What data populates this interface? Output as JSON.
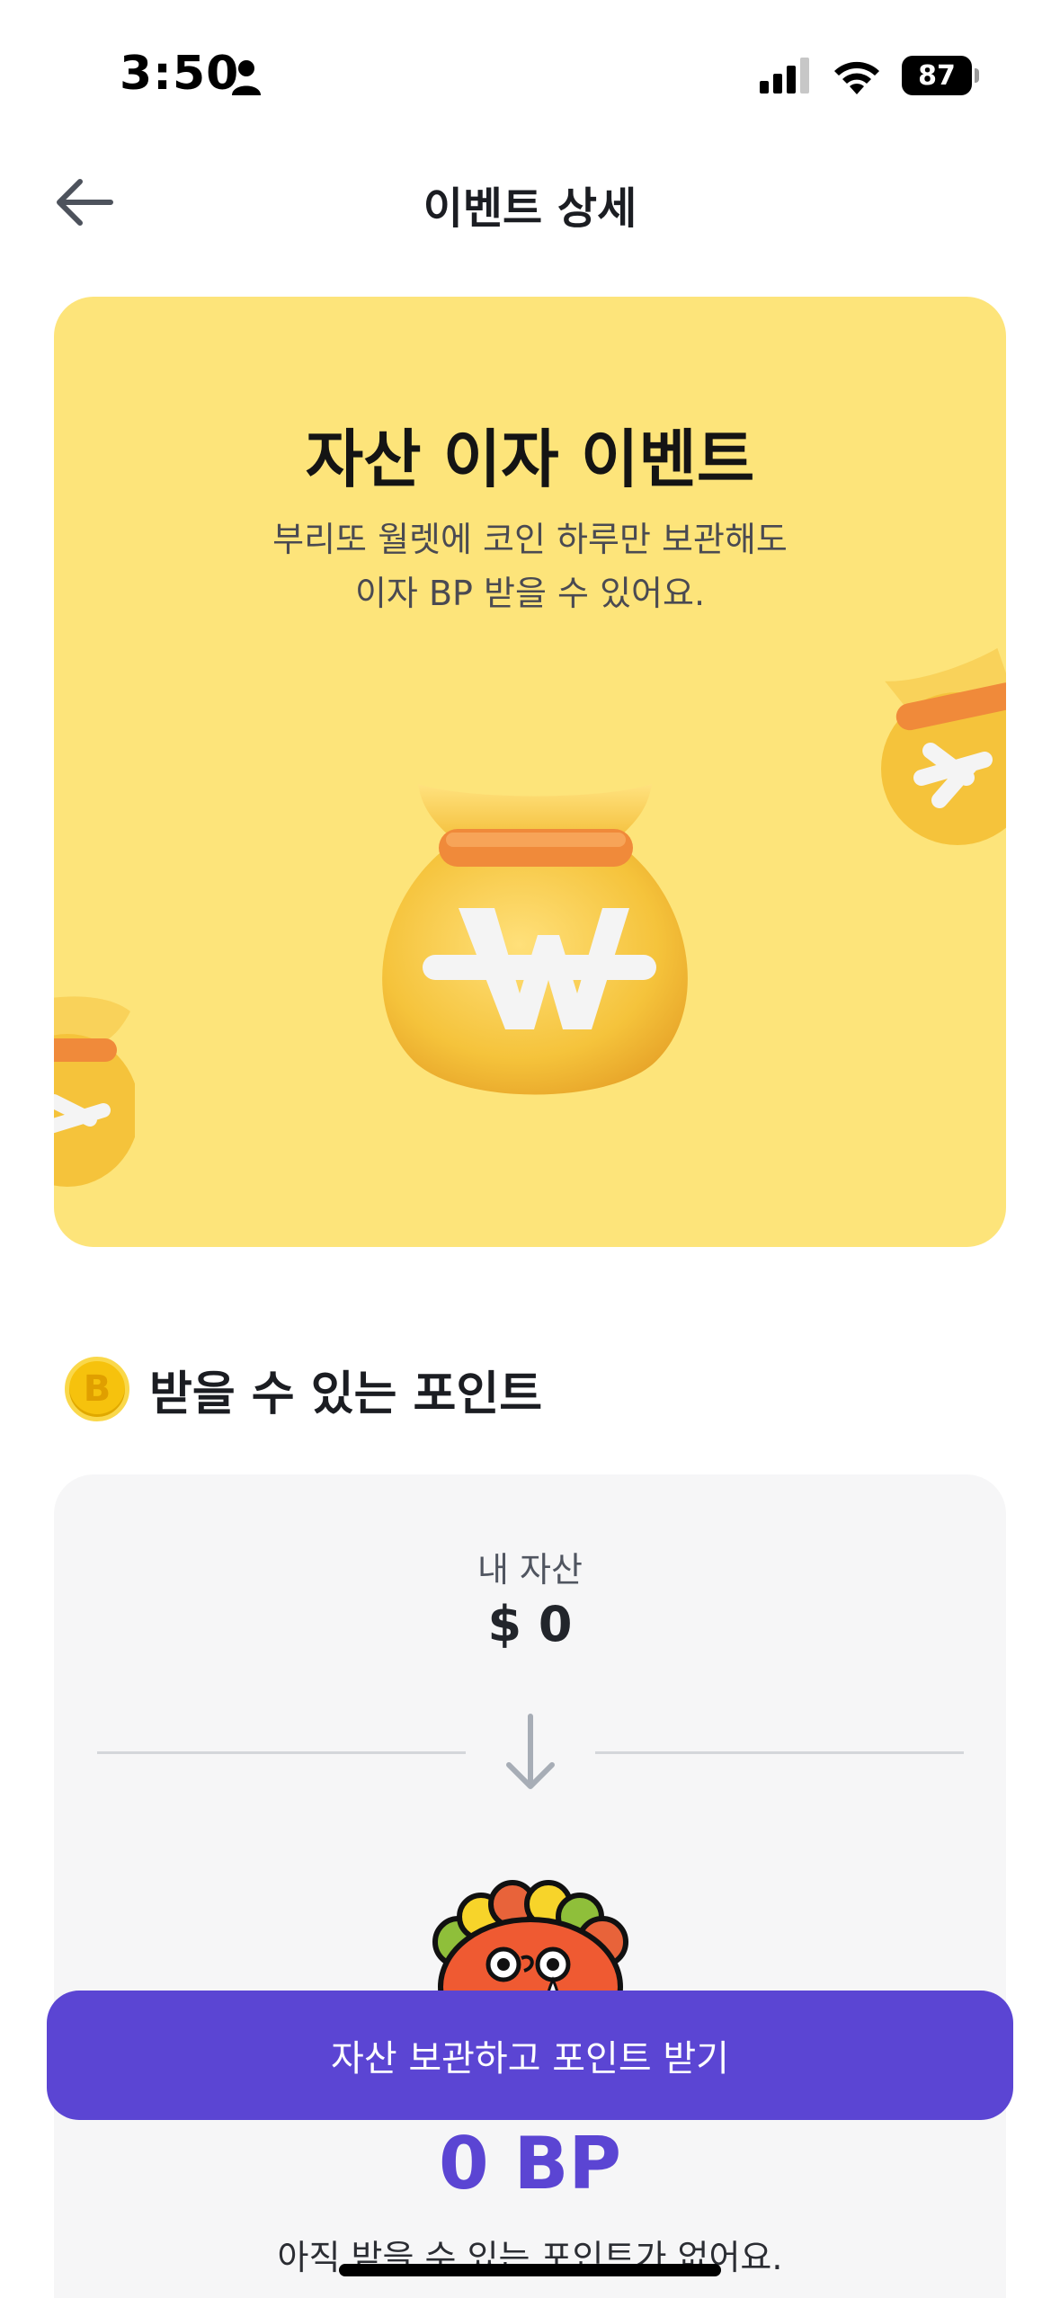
{
  "status_bar": {
    "time": "3:50",
    "battery": "87"
  },
  "nav": {
    "title": "이벤트 상세"
  },
  "hero": {
    "title": "자산 이자 이벤트",
    "subtitle_line1": "부리또 월렛에 코인 하루만 보관해도",
    "subtitle_line2": "이자 BP 받을 수 있어요.",
    "background_color": "#fde47a"
  },
  "section": {
    "coin_letter": "B",
    "title": "받을 수 있는 포인트"
  },
  "points_card": {
    "asset_label": "내 자산",
    "asset_value": "$ 0",
    "bp_value": "0 BP",
    "no_points_text": "아직 받을 수 있는 포인트가 없어요."
  },
  "cta": {
    "label": "자산 보관하고 포인트 받기",
    "color": "#5b45d3"
  }
}
